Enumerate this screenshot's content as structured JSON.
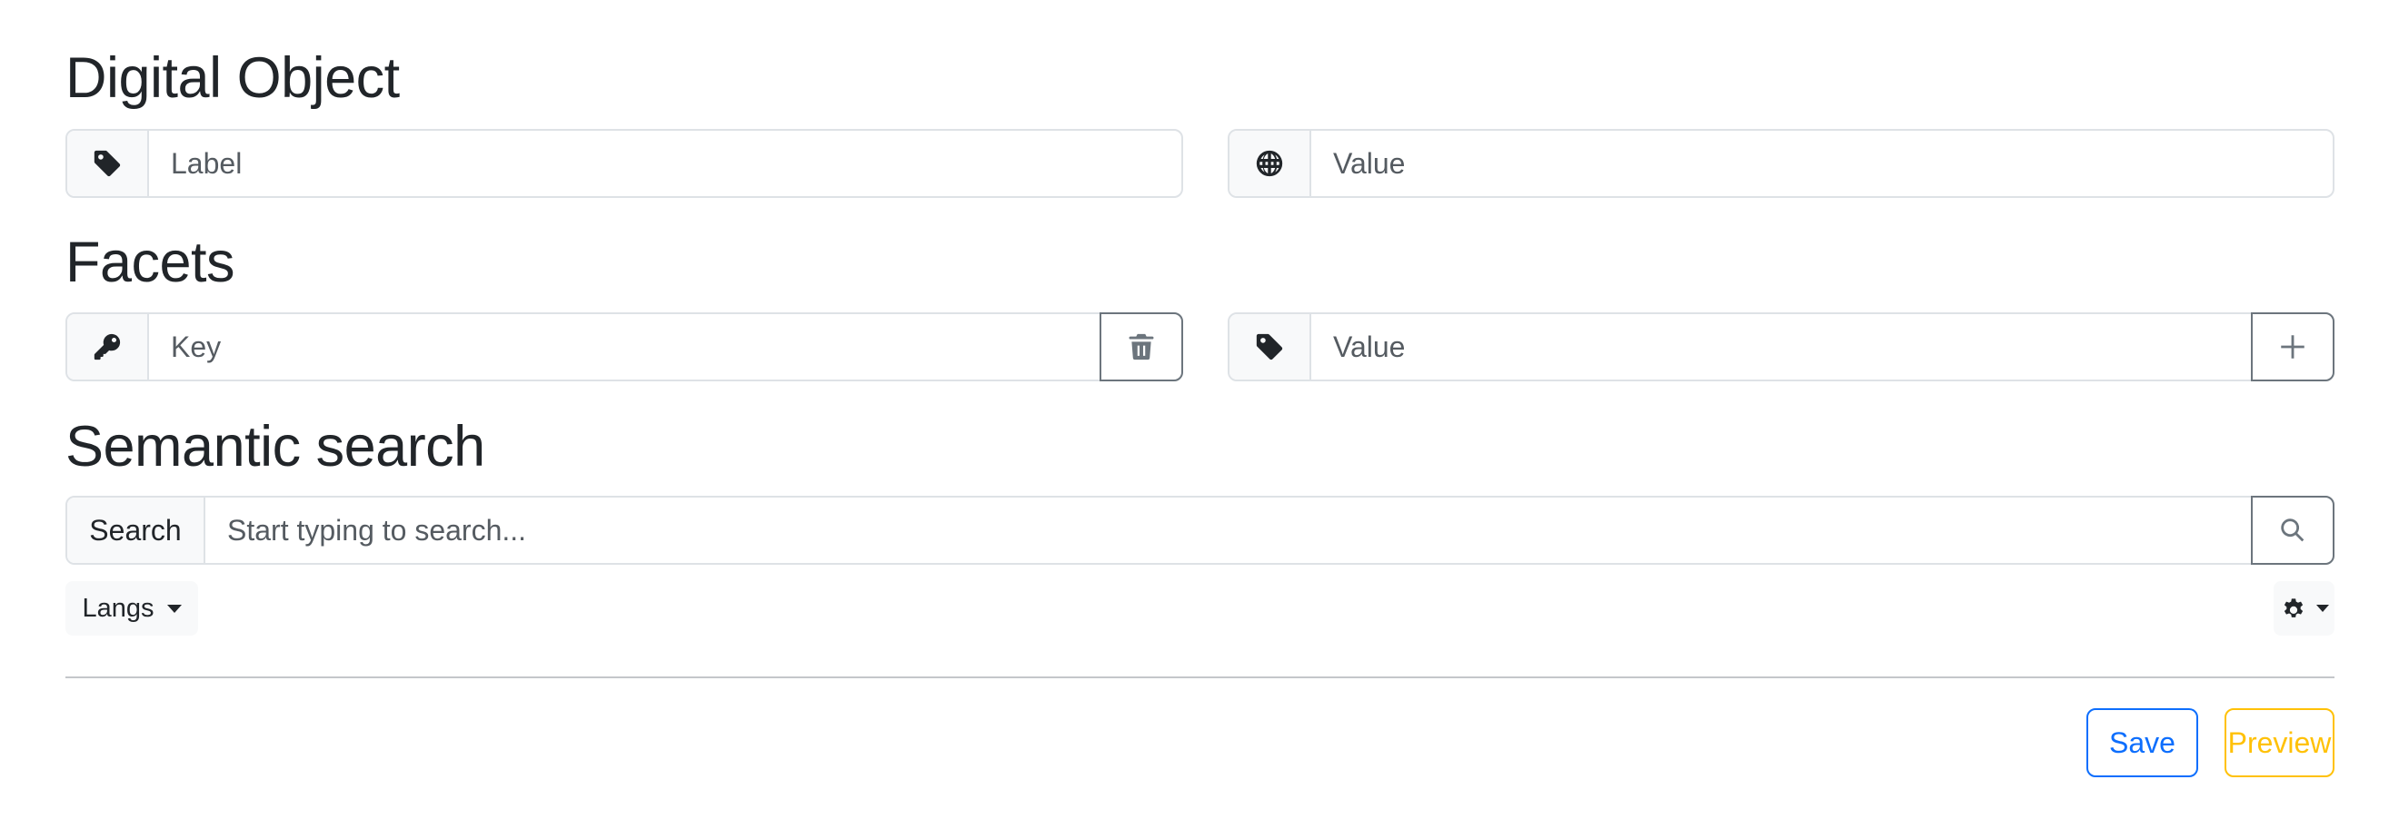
{
  "sections": {
    "digital_object": {
      "title": "Digital Object",
      "label_placeholder": "Label",
      "value_placeholder": "Value",
      "label_icon": "tag-icon",
      "value_icon": "globe-icon"
    },
    "facets": {
      "title": "Facets",
      "key_placeholder": "Key",
      "value_placeholder": "Value",
      "key_icon": "key-icon",
      "value_icon": "tag-icon",
      "delete_icon": "trash-icon",
      "add_icon": "plus-icon"
    },
    "semantic_search": {
      "title": "Semantic search",
      "search_addon": "Search",
      "search_placeholder": "Start typing to search...",
      "search_icon": "search-icon",
      "langs_label": "Langs",
      "settings_icon": "gear-icon"
    }
  },
  "actions": {
    "save_label": "Save",
    "preview_label": "Preview"
  },
  "colors": {
    "save": "#0d6efd",
    "preview": "#ffc107",
    "border": "#dee2e6",
    "outline_button": "#6c757d"
  }
}
